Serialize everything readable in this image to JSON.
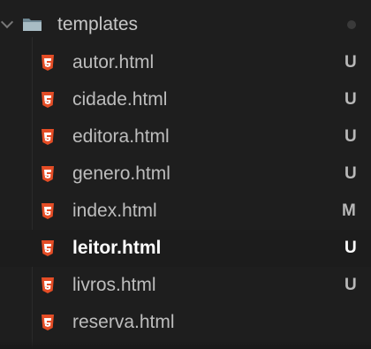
{
  "explorer": {
    "folder": {
      "name": "templates",
      "icon": "folder-open-icon",
      "indicator": "modified-dot",
      "indicator_color": "#3a3a3a"
    },
    "files": [
      {
        "name": "autor.html",
        "status": "U",
        "icon": "html5-icon"
      },
      {
        "name": "cidade.html",
        "status": "U",
        "icon": "html5-icon"
      },
      {
        "name": "editora.html",
        "status": "U",
        "icon": "html5-icon"
      },
      {
        "name": "genero.html",
        "status": "U",
        "icon": "html5-icon"
      },
      {
        "name": "index.html",
        "status": "M",
        "icon": "html5-icon"
      },
      {
        "name": "leitor.html",
        "status": "U",
        "icon": "html5-icon",
        "selected": true
      },
      {
        "name": "livros.html",
        "status": "U",
        "icon": "html5-icon"
      },
      {
        "name": "reserva.html",
        "status": "",
        "icon": "html5-icon"
      }
    ],
    "colors": {
      "background": "#1e1e1e",
      "html_icon": "#e44d26",
      "folder_icon": "#90a4ae",
      "text": "#bdbdbd",
      "selected_text": "#ffffff"
    }
  }
}
